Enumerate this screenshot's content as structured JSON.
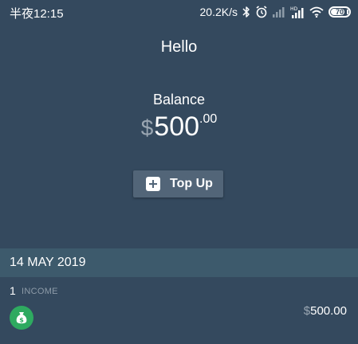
{
  "status_bar": {
    "time": "半夜12:15",
    "net_speed": "20.2K/s",
    "battery_level": "70",
    "icons": [
      "bluetooth-icon",
      "alarm-icon",
      "signal-icon",
      "hd-signal-icon",
      "wifi-icon",
      "battery-icon"
    ]
  },
  "header": {
    "greeting": "Hello",
    "balance_label": "Balance",
    "balance_currency": "$",
    "balance_main": "500",
    "balance_cents": ".00"
  },
  "actions": {
    "top_up_label": "Top Up",
    "top_up_icon": "plus-square-icon"
  },
  "transactions": {
    "date": "14 MAY 2019",
    "items": [
      {
        "count": "1",
        "type": "INCOME",
        "icon": "money-bag-icon",
        "currency": "$",
        "amount": "500.00"
      }
    ]
  },
  "colors": {
    "background": "#34495E",
    "date_header_bg": "#3D5A6C",
    "button_bg": "#526578",
    "income_icon_bg": "#2EAA60",
    "muted_text": "#9AA6B2"
  }
}
